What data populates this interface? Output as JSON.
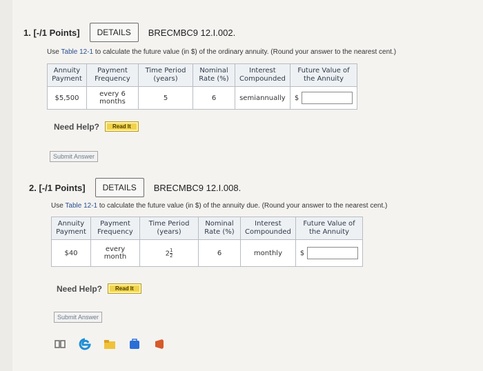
{
  "questions": [
    {
      "number": "1. [-/1 Points]",
      "details_label": "DETAILS",
      "code": "BRECMBC9 12.I.002.",
      "instruction_pre": "Use ",
      "instruction_link": "Table 12-1",
      "instruction_post": " to calculate the future value (in $) of the ordinary annuity. (Round your answer to the nearest cent.)",
      "headers": [
        "Annuity Payment",
        "Payment Frequency",
        "Time Period (years)",
        "Nominal Rate (%)",
        "Interest Compounded",
        "Future Value of the Annuity"
      ],
      "row": {
        "payment": "$5,500",
        "frequency": "every 6 months",
        "time": "5",
        "rate": "6",
        "compounded": "semiannually",
        "currency": "$"
      },
      "help_label": "Need Help?",
      "read_label": "Read It",
      "submit_label": "Submit Answer"
    },
    {
      "number": "2. [-/1 Points]",
      "details_label": "DETAILS",
      "code": "BRECMBC9 12.I.008.",
      "instruction_pre": "Use ",
      "instruction_link": "Table 12-1",
      "instruction_post": " to calculate the future value (in $) of the annuity due. (Round your answer to the nearest cent.)",
      "headers": [
        "Annuity Payment",
        "Payment Frequency",
        "Time Period (years)",
        "Nominal Rate (%)",
        "Interest Compounded",
        "Future Value of the Annuity"
      ],
      "row": {
        "payment": "$40",
        "frequency": "every month",
        "time_whole": "2",
        "time_num": "1",
        "time_den": "2",
        "rate": "6",
        "compounded": "monthly",
        "currency": "$"
      },
      "help_label": "Need Help?",
      "read_label": "Read It",
      "submit_label": "Submit Answer"
    }
  ],
  "taskbar": {
    "icons": [
      "task-view-icon",
      "edge-browser-icon",
      "file-explorer-icon",
      "store-icon",
      "office-icon"
    ],
    "colors": {
      "edge": "#1f8fd6",
      "explorer": "#f0c23a",
      "store": "#2a6fd6",
      "office": "#d65a2a"
    }
  }
}
